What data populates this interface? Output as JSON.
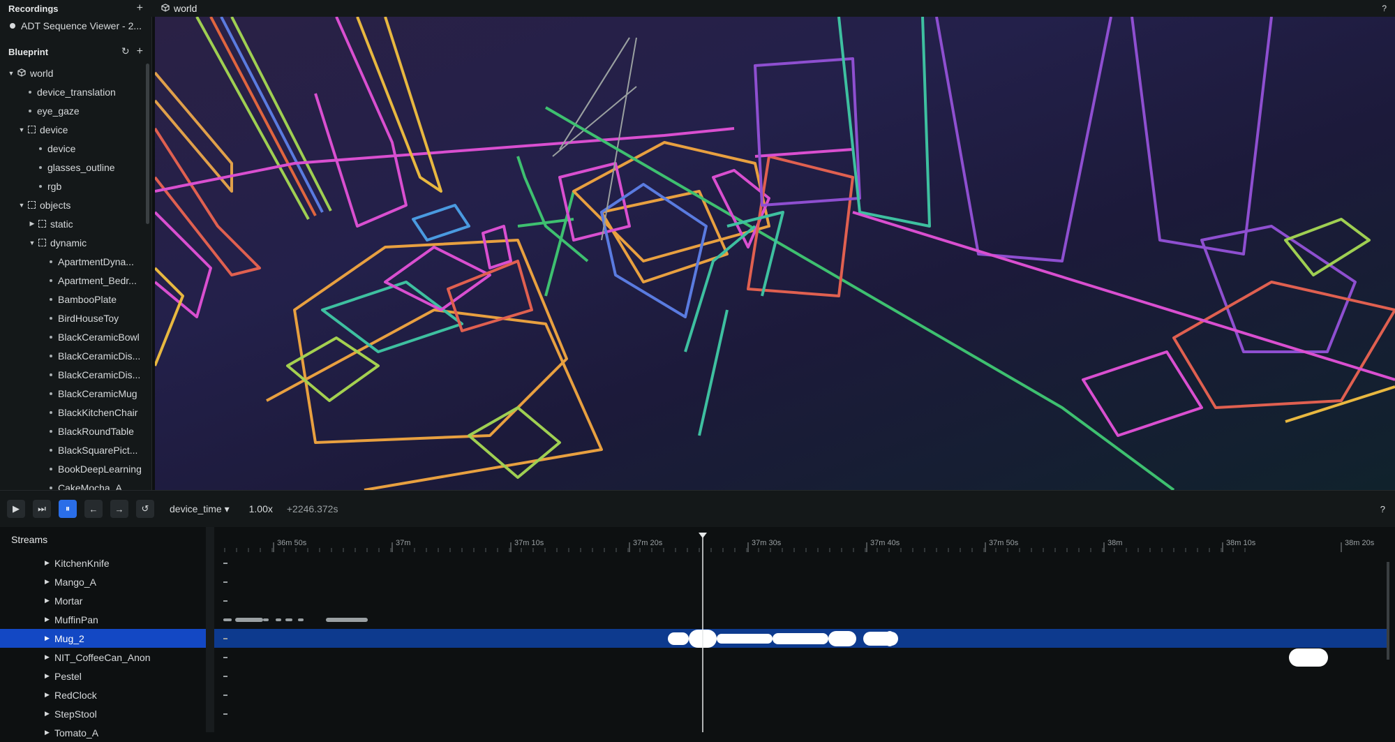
{
  "recordings": {
    "title": "Recordings",
    "item": "ADT Sequence Viewer - 2..."
  },
  "blueprint": {
    "title": "Blueprint",
    "items": [
      {
        "label": "world",
        "kind": "cube",
        "indent": 0,
        "expanded": true
      },
      {
        "label": "device_translation",
        "kind": "leaf",
        "indent": 1
      },
      {
        "label": "eye_gaze",
        "kind": "leaf",
        "indent": 1
      },
      {
        "label": "device",
        "kind": "group",
        "indent": 1,
        "expanded": true
      },
      {
        "label": "device",
        "kind": "leaf",
        "indent": 2
      },
      {
        "label": "glasses_outline",
        "kind": "leaf",
        "indent": 2
      },
      {
        "label": "rgb",
        "kind": "leaf",
        "indent": 2
      },
      {
        "label": "objects",
        "kind": "group",
        "indent": 1,
        "expanded": true
      },
      {
        "label": "static",
        "kind": "group",
        "indent": 2,
        "expanded": false
      },
      {
        "label": "dynamic",
        "kind": "group",
        "indent": 2,
        "expanded": true
      },
      {
        "label": "ApartmentDyna...",
        "kind": "leaf",
        "indent": 3
      },
      {
        "label": "Apartment_Bedr...",
        "kind": "leaf",
        "indent": 3
      },
      {
        "label": "BambooPlate",
        "kind": "leaf",
        "indent": 3
      },
      {
        "label": "BirdHouseToy",
        "kind": "leaf",
        "indent": 3
      },
      {
        "label": "BlackCeramicBowl",
        "kind": "leaf",
        "indent": 3
      },
      {
        "label": "BlackCeramicDis...",
        "kind": "leaf",
        "indent": 3
      },
      {
        "label": "BlackCeramicDis...",
        "kind": "leaf",
        "indent": 3
      },
      {
        "label": "BlackCeramicMug",
        "kind": "leaf",
        "indent": 3
      },
      {
        "label": "BlackKitchenChair",
        "kind": "leaf",
        "indent": 3
      },
      {
        "label": "BlackRoundTable",
        "kind": "leaf",
        "indent": 3
      },
      {
        "label": "BlackSquarePict...",
        "kind": "leaf",
        "indent": 3
      },
      {
        "label": "BookDeepLearning",
        "kind": "leaf",
        "indent": 3
      },
      {
        "label": "CakeMocha_A",
        "kind": "leaf",
        "indent": 3
      }
    ]
  },
  "viewport": {
    "title": "world",
    "help": "?"
  },
  "timebar": {
    "timeline": "device_time",
    "speed": "1.00x",
    "offset": "+2246.372s",
    "help": "?"
  },
  "streams": {
    "title": "Streams",
    "ticks": [
      "36m 50s",
      "37m",
      "37m 10s",
      "37m 20s",
      "37m 30s",
      "37m 40s",
      "37m 50s",
      "38m",
      "38m 10s",
      "38m 20s"
    ],
    "rows": [
      "KitchenKnife",
      "Mango_A",
      "Mortar",
      "MuffinPan",
      "Mug_2",
      "NIT_CoffeeCan_Anon",
      "Pestel",
      "RedClock",
      "StepStool",
      "Tomato_A"
    ],
    "selected": "Mug_2"
  }
}
